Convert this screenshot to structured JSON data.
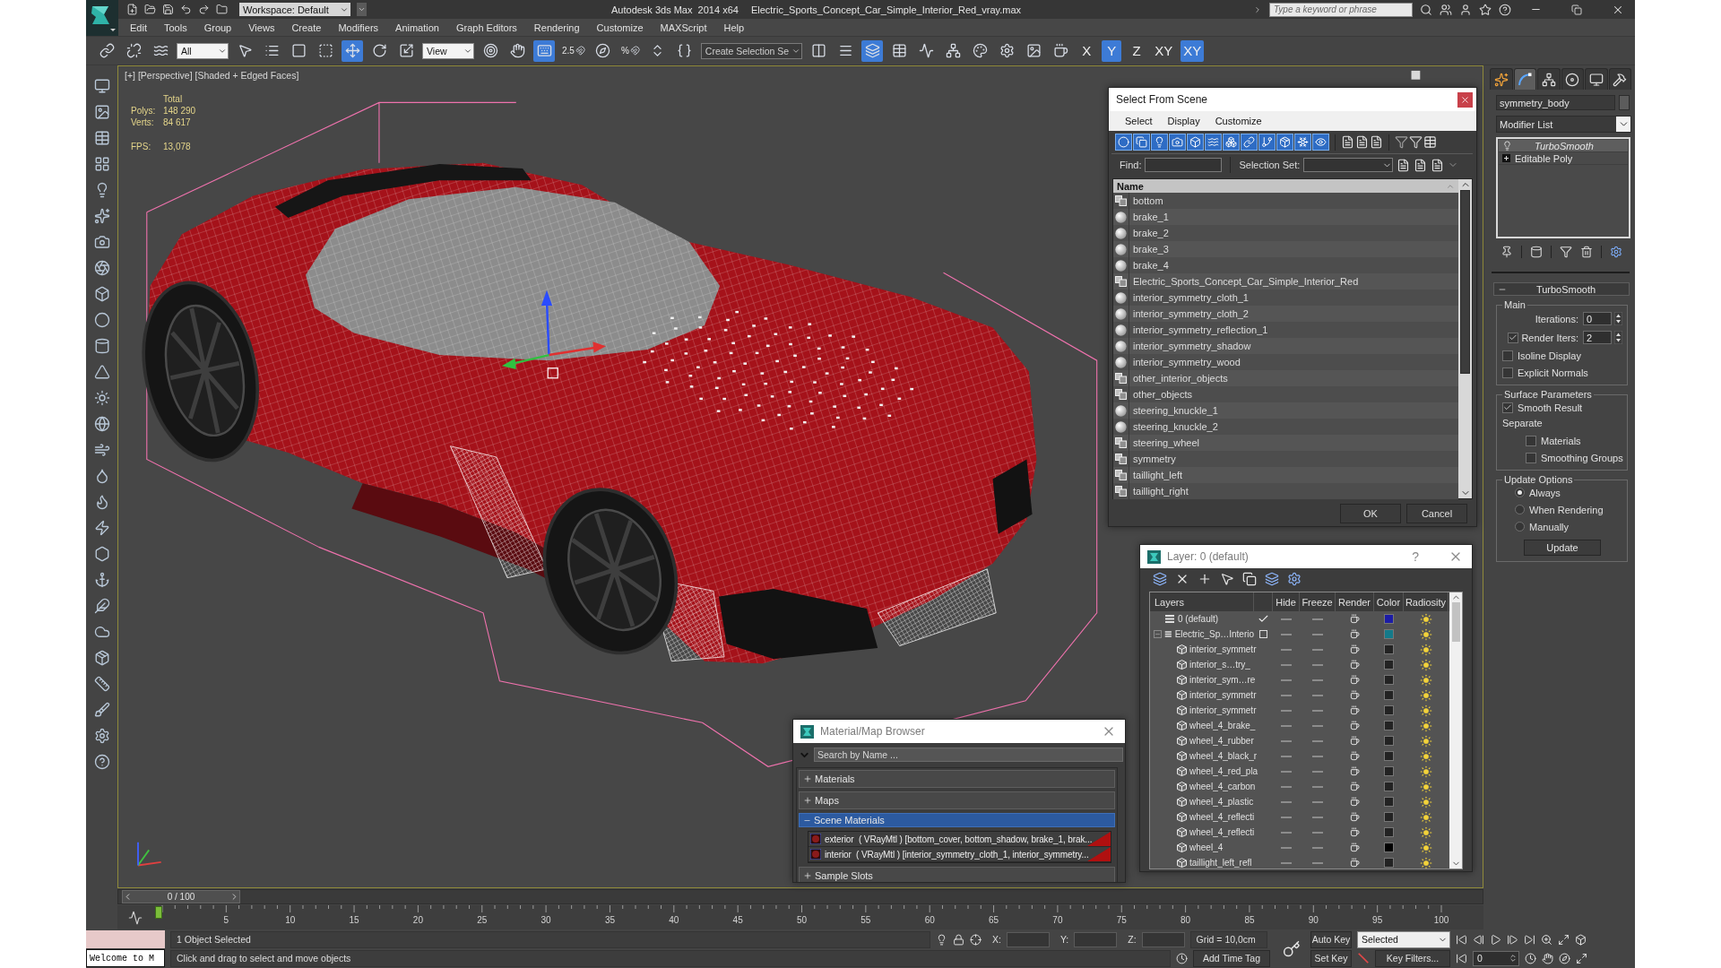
{
  "title_bar": {
    "workspace": "Workspace: Default",
    "app": "Autodesk 3ds Max  2014 x64",
    "file": "Electric_Sports_Concept_Car_Simple_Interior_Red_vray.max",
    "search": {
      "placeholder": "Type a keyword or phrase"
    }
  },
  "menu": [
    "Edit",
    "Tools",
    "Group",
    "Views",
    "Create",
    "Modifiers",
    "Animation",
    "Graph Editors",
    "Rendering",
    "Customize",
    "MAXScript",
    "Help"
  ],
  "toolbar": {
    "buttons": [
      {
        "kind": "link",
        "selected": false
      },
      {
        "kind": "unlink",
        "selected": false
      },
      {
        "kind": "bind",
        "selected": false
      },
      {
        "kind": "dropdown",
        "value": "All"
      },
      {
        "kind": "select",
        "selected": false
      },
      {
        "kind": "select_by_name",
        "selected": false
      },
      {
        "kind": "region",
        "selected": false
      },
      {
        "kind": "crossing",
        "selected": false
      },
      {
        "kind": "move",
        "selected": true
      },
      {
        "kind": "rotate",
        "selected": false
      },
      {
        "kind": "scale",
        "selected": false
      },
      {
        "kind": "dropdown",
        "value": "View"
      },
      {
        "kind": "pivot",
        "selected": false
      },
      {
        "kind": "manipulate",
        "selected": false
      },
      {
        "kind": "shortcut_override",
        "selected": true
      },
      {
        "kind": "snap",
        "label": "2.5",
        "selected": false
      },
      {
        "kind": "angle_snap",
        "selected": false
      },
      {
        "kind": "percent_snap",
        "label": "%",
        "selected": false
      },
      {
        "kind": "spinner_snap",
        "selected": false
      },
      {
        "kind": "named_sets",
        "selected": false
      },
      {
        "kind": "combo",
        "value": "Create Selection Se"
      },
      {
        "kind": "mirror",
        "selected": false
      },
      {
        "kind": "align",
        "selected": false
      },
      {
        "kind": "layers",
        "selected": true
      },
      {
        "kind": "scene_explorer",
        "selected": false
      },
      {
        "kind": "curve_editor",
        "selected": false
      },
      {
        "kind": "schematic",
        "selected": false
      },
      {
        "kind": "material_editor",
        "selected": false
      },
      {
        "kind": "render_setup",
        "selected": false
      },
      {
        "kind": "rendered_frame",
        "selected": false
      },
      {
        "kind": "render",
        "selected": false
      },
      {
        "kind": "axis",
        "label": "X",
        "selected": false
      },
      {
        "kind": "axis",
        "label": "Y",
        "selected": true
      },
      {
        "kind": "axis",
        "label": "Z",
        "selected": false
      },
      {
        "kind": "axis",
        "label": "XY",
        "selected": false
      },
      {
        "kind": "axis",
        "label": "XY",
        "selected": true
      }
    ]
  },
  "viewport": {
    "label": "[+] [Perspective] [Shaded + Edged Faces]",
    "stats_heading": "Total",
    "stats": [
      {
        "label": "Polys:",
        "value": "148 290"
      },
      {
        "label": "Verts:",
        "value": "84 617"
      }
    ],
    "fps": {
      "label": "FPS:",
      "value": "13,078"
    }
  },
  "select_from_scene": {
    "title": "Select From Scene",
    "menu": [
      "Select",
      "Display",
      "Customize"
    ],
    "filters": [
      {
        "kind": "geometry",
        "on": true
      },
      {
        "kind": "shapes",
        "on": true
      },
      {
        "kind": "lights",
        "on": true
      },
      {
        "kind": "cameras",
        "on": true
      },
      {
        "kind": "helpers",
        "on": true
      },
      {
        "kind": "spacewarps",
        "on": true
      },
      {
        "kind": "groups",
        "on": true
      },
      {
        "kind": "xrefs",
        "on": true
      },
      {
        "kind": "bones",
        "on": true
      },
      {
        "kind": "containers",
        "on": true
      },
      {
        "kind": "frozen",
        "on": true
      },
      {
        "kind": "hidden",
        "on": true
      }
    ],
    "find_label": "Find:",
    "selection_set_label": "Selection Set:",
    "column": "Name",
    "rows": [
      {
        "name": "bottom",
        "kind": "group",
        "selected": false
      },
      {
        "name": "brake_1",
        "kind": "object",
        "selected": false
      },
      {
        "name": "brake_2",
        "kind": "object",
        "selected": false
      },
      {
        "name": "brake_3",
        "kind": "object",
        "selected": false
      },
      {
        "name": "brake_4",
        "kind": "object",
        "selected": false
      },
      {
        "name": "Electric_Sports_Concept_Car_Simple_Interior_Red",
        "kind": "group",
        "selected": false
      },
      {
        "name": "interior_symmetry_cloth_1",
        "kind": "object",
        "selected": false
      },
      {
        "name": "interior_symmetry_cloth_2",
        "kind": "object",
        "selected": false
      },
      {
        "name": "interior_symmetry_reflection_1",
        "kind": "object",
        "selected": false
      },
      {
        "name": "interior_symmetry_shadow",
        "kind": "object",
        "selected": false
      },
      {
        "name": "interior_symmetry_wood",
        "kind": "object",
        "selected": false
      },
      {
        "name": "other_interior_objects",
        "kind": "group",
        "selected": false
      },
      {
        "name": "other_objects",
        "kind": "group",
        "selected": false
      },
      {
        "name": "steering_knuckle_1",
        "kind": "object",
        "selected": false
      },
      {
        "name": "steering_knuckle_2",
        "kind": "object",
        "selected": false
      },
      {
        "name": "steering_wheel",
        "kind": "group",
        "selected": false
      },
      {
        "name": "symmetry",
        "kind": "group",
        "selected": false
      },
      {
        "name": "taillight_left",
        "kind": "group",
        "selected": false
      },
      {
        "name": "taillight_right",
        "kind": "group",
        "selected": false
      }
    ],
    "buttons": [
      "OK",
      "Cancel"
    ]
  },
  "command_panel": {
    "tabs": [
      {
        "kind": "create",
        "selected": false
      },
      {
        "kind": "modify",
        "selected": true
      },
      {
        "kind": "hierarchy",
        "selected": false
      },
      {
        "kind": "motion",
        "selected": false
      },
      {
        "kind": "display",
        "selected": false
      },
      {
        "kind": "utilities",
        "selected": false
      }
    ],
    "object_name": "symmetry_body",
    "modifier_list": "Modifier List",
    "stack": [
      {
        "name": "TurboSmooth",
        "kind": "modifier",
        "selected": true
      },
      {
        "name": "Editable Poly",
        "kind": "base",
        "selected": false
      }
    ],
    "rollout": {
      "title": "TurboSmooth",
      "expanded": true,
      "groups": [
        {
          "title": "Main",
          "controls": [
            {
              "kind": "spinner",
              "label": "Iterations:",
              "value": "0"
            },
            {
              "kind": "check_spinner",
              "label": "Render Iters:",
              "value": "2",
              "checked": true
            },
            {
              "kind": "checkbox",
              "label": "Isoline Display",
              "checked": false
            },
            {
              "kind": "checkbox",
              "label": "Explicit Normals",
              "checked": false
            }
          ]
        },
        {
          "title": "Surface Parameters",
          "controls": [
            {
              "kind": "checkbox",
              "label": "Smooth Result",
              "checked": true
            },
            {
              "kind": "heading",
              "label": "Separate",
              "children": [
                {
                  "kind": "checkbox",
                  "label": "Materials",
                  "checked": false
                },
                {
                  "kind": "checkbox",
                  "label": "Smoothing Groups",
                  "checked": false
                }
              ]
            }
          ]
        },
        {
          "title": "Update Options",
          "controls": [
            {
              "kind": "radio",
              "label": "Always",
              "selected": true
            },
            {
              "kind": "radio",
              "label": "When Rendering",
              "selected": false
            },
            {
              "kind": "radio",
              "label": "Manually",
              "selected": false
            },
            {
              "kind": "button",
              "label": "Update"
            }
          ]
        }
      ]
    }
  },
  "layer_dialog": {
    "title": "Layer: 0 (default)",
    "help": "?",
    "columns": [
      "Layers",
      "Hide",
      "Freeze",
      "Render",
      "Color",
      "Radiosity"
    ],
    "rows": [
      {
        "name": "0 (default)",
        "current": true,
        "color": "#1c1ca6"
      },
      {
        "name": "Electric_Sp…Interio",
        "current": false,
        "expanded": true,
        "color": "#147a8a",
        "children": [
          {
            "name": "interior_symmetr",
            "color": "#232323"
          },
          {
            "name": "interior_s…try_",
            "color": "#232323"
          },
          {
            "name": "interior_sym…re",
            "color": "#232323"
          },
          {
            "name": "interior_symmetr",
            "color": "#232323"
          },
          {
            "name": "interior_symmetr",
            "color": "#232323"
          },
          {
            "name": "wheel_4_brake_",
            "color": "#232323"
          },
          {
            "name": "wheel_4_rubber",
            "color": "#232323"
          },
          {
            "name": "wheel_4_black_r",
            "color": "#232323"
          },
          {
            "name": "wheel_4_red_pla",
            "color": "#232323"
          },
          {
            "name": "wheel_4_carbon",
            "color": "#232323"
          },
          {
            "name": "wheel_4_plastic",
            "color": "#232323"
          },
          {
            "name": "wheel_4_reflecti",
            "color": "#232323"
          },
          {
            "name": "wheel_4_reflecti",
            "color": "#232323"
          },
          {
            "name": "wheel_4",
            "color": "#000000"
          },
          {
            "name": "taillight_left_refl",
            "color": "#232323"
          }
        ]
      }
    ]
  },
  "material_browser": {
    "title": "Material/Map Browser",
    "search": {
      "placeholder": "Search by Name ..."
    },
    "groups": [
      {
        "label": "Materials",
        "expanded": false
      },
      {
        "label": "Maps",
        "expanded": false
      },
      {
        "label": "Scene Materials",
        "expanded": true,
        "items": [
          {
            "text": "exterior  ( VRayMtl ) [bottom_cover, bottom_shadow, brake_1, brak..."
          },
          {
            "text": "interior  ( VRayMtl ) [interior_symmetry_cloth_1, interior_symmetry..."
          }
        ]
      },
      {
        "label": "Sample Slots",
        "expanded": false
      }
    ]
  },
  "time_slider": {
    "label": "0 / 100",
    "level": 0
  },
  "track_bar": {
    "labels": [
      "5",
      "10",
      "15",
      "20",
      "25",
      "30",
      "35",
      "40",
      "45",
      "50",
      "55",
      "60",
      "65",
      "70",
      "75",
      "80",
      "85",
      "90",
      "95",
      "100"
    ]
  },
  "status": {
    "listener": "Welcome to M",
    "selection": "1 Object Selected",
    "prompt": "Click and drag to select and move objects",
    "coords": [
      "X:",
      "Y:",
      "Z:"
    ],
    "grid": "Grid = 10,0cm",
    "time_tag": "Add Time Tag",
    "auto_key": {
      "label": "Auto Key",
      "on": false
    },
    "set_key": "Set Key",
    "key_mode": "Selected",
    "key_filters": "Key Filters...",
    "frame": "0"
  }
}
